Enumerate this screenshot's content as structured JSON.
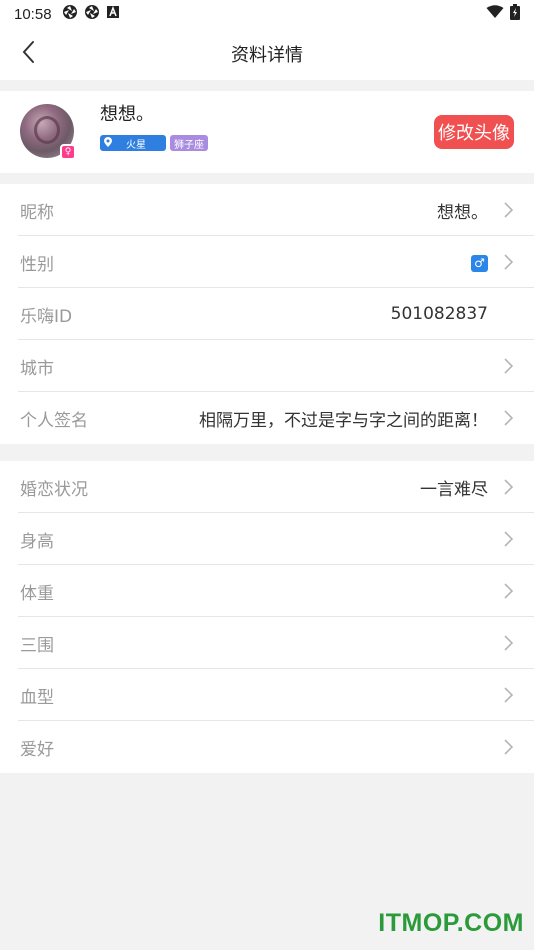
{
  "status_bar": {
    "time": "10:58",
    "left_icons": [
      "aperture-icon",
      "aperture-icon",
      "text-a-icon"
    ],
    "right_icons": [
      "wifi-icon",
      "battery-charging-icon"
    ]
  },
  "nav": {
    "title": "资料详情",
    "back_icon": "chevron-left-icon"
  },
  "profile": {
    "name": "想想。",
    "tag_planet": "火星",
    "tag_zodiac": "狮子座",
    "edit_avatar_label": "修改头像",
    "badge_icon": "female-badge-icon"
  },
  "section1": [
    {
      "label": "昵称",
      "value": "想想。",
      "arrow": true
    },
    {
      "label": "性别",
      "value": "",
      "gender_icon": "male-icon",
      "arrow": true
    },
    {
      "label": "乐嗨ID",
      "value": "501082837",
      "arrow": false
    },
    {
      "label": "城市",
      "value": "",
      "arrow": true
    },
    {
      "label": "个人签名",
      "value": "相隔万里，不过是字与字之间的距离！",
      "arrow": true
    }
  ],
  "section2": [
    {
      "label": "婚恋状况",
      "value": "一言难尽",
      "arrow": true
    },
    {
      "label": "身高",
      "value": "",
      "arrow": true
    },
    {
      "label": "体重",
      "value": "",
      "arrow": true
    },
    {
      "label": "三围",
      "value": "",
      "arrow": true
    },
    {
      "label": "血型",
      "value": "",
      "arrow": true
    },
    {
      "label": "爱好",
      "value": "",
      "arrow": true
    }
  ],
  "watermark": "ITMOP.COM",
  "colors": {
    "accent_blue": "#2f7fe0",
    "zodiac_purple": "#a98be0",
    "edit_button_red": "#f05050",
    "watermark_green": "#2a9a3a"
  }
}
